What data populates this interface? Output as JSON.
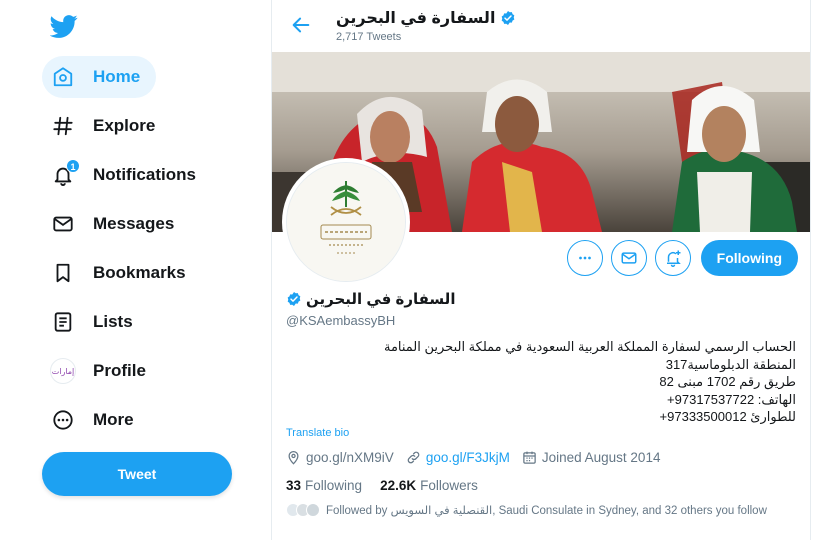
{
  "nav": {
    "items": [
      {
        "label": "Home",
        "icon": "home-icon",
        "active": true
      },
      {
        "label": "Explore",
        "icon": "hashtag-icon"
      },
      {
        "label": "Notifications",
        "icon": "bell-icon",
        "badge": "1"
      },
      {
        "label": "Messages",
        "icon": "envelope-icon"
      },
      {
        "label": "Bookmarks",
        "icon": "bookmark-icon"
      },
      {
        "label": "Lists",
        "icon": "list-icon"
      },
      {
        "label": "Profile",
        "icon": "profile-avatar",
        "avatar_text": "إمارات"
      },
      {
        "label": "More",
        "icon": "more-icon"
      }
    ],
    "tweet_button": "Tweet"
  },
  "header": {
    "title": "السفارة في البحرين",
    "tweet_count": "2,717 Tweets"
  },
  "profile": {
    "name": "السفارة في البحرين",
    "handle": "@KSAembassyBH",
    "bio_lines": [
      "الحساب الرسمي لسفارة المملكة العربية السعودية في مملكة البحرين المنامة",
      "المنطقة الدبلوماسية317",
      "طريق رقم 1702 مبنى 82",
      "الهاتف: 97317537722+",
      "للطوارئ 97333500012+"
    ],
    "translate_label": "Translate bio",
    "location_link": "goo.gl/nXM9iV",
    "website_link": "goo.gl/F3JkjM",
    "joined": "Joined August 2014",
    "following_count": "33",
    "following_label": "Following",
    "followers_count": "22.6K",
    "followers_label": "Followers",
    "followed_by": "Followed by القنصلية في السويس, Saudi Consulate in Sydney, and 32 others you follow",
    "following_button": "Following"
  },
  "colors": {
    "accent": "#1da1f2",
    "text": "#14171a",
    "muted": "#657786",
    "active_bg": "#e8f5fe"
  }
}
